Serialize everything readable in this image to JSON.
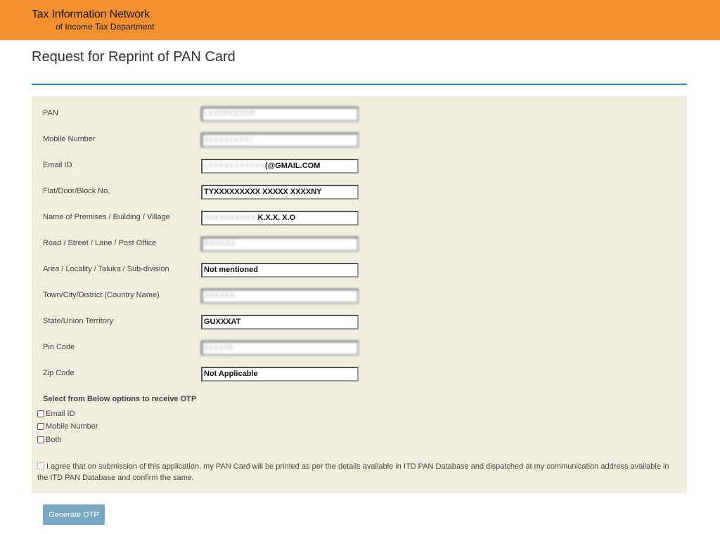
{
  "header": {
    "brand_line1": "Tax Information Network",
    "brand_line2": "of Income Tax Department",
    "background_color": "#f39030"
  },
  "page": {
    "title": "Request for Reprint of PAN Card",
    "rule_color": "#2d82b5",
    "panel_color": "#efeedf"
  },
  "form": {
    "fields": [
      {
        "label": "PAN",
        "value": "LXXXPXXXXR",
        "blurred": true
      },
      {
        "label": "Mobile Number",
        "value": "9XXXXXXXX7",
        "blurred": true
      },
      {
        "label": "Email ID",
        "value_prefix": "LXXXXXXXXXXX",
        "value": "(@GMAIL.COM",
        "blurred_prefix": true
      },
      {
        "label": "Flat/Door/Block No.",
        "value": "TYXXXXXXXXX XXXXX XXXXNY",
        "blurred": false
      },
      {
        "label": "Name of Premises / Building / Village",
        "value_prefix": "XXXXXXXXXX",
        "value": "K.X.X. X.O",
        "blurred_prefix": true
      },
      {
        "label": "Road / Street / Lane / Post Office",
        "value": "RXXXXA",
        "blurred": true
      },
      {
        "label": "Area / Locality / Taluka / Sub-division",
        "value": "Not mentioned",
        "blurred": false
      },
      {
        "label": "Town/City/District (Country Name)",
        "value": "AXXXXX",
        "blurred": true
      },
      {
        "label": "State/Union Territory",
        "value": "GUXXXAT",
        "blurred": false
      },
      {
        "label": "Pin Code",
        "value": "3XXXX8",
        "blurred": true
      },
      {
        "label": "Zip Code",
        "value": "Not Applicable",
        "blurred": false
      }
    ],
    "otp_heading": "Select from Below options to receive OTP",
    "otp_options": [
      "Email ID",
      "Mobile Number",
      "Both"
    ],
    "agreement_text": "I agree that on submission of this application, my PAN Card will be printed as per the details available in ITD PAN Database and dispatched at my communication address available in the ITD PAN Database and confirm the same.",
    "agreement_checked": false
  },
  "actions": {
    "generate_otp_label": "Generate OTP",
    "button_color": "#76a9bf"
  }
}
